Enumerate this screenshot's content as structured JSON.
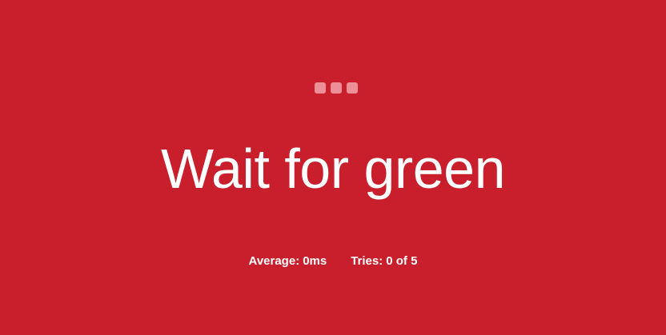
{
  "screen": {
    "background_color": "#c91f2c",
    "status": "waiting"
  },
  "indicator": {
    "icon": "three-dots-icon",
    "dot_count": 3,
    "dot_color": "#ec8f97"
  },
  "title": "Wait for green",
  "stats": {
    "average_label": "Average:",
    "average_value": "0ms",
    "tries_label": "Tries:",
    "tries_value": "0 of 5"
  }
}
